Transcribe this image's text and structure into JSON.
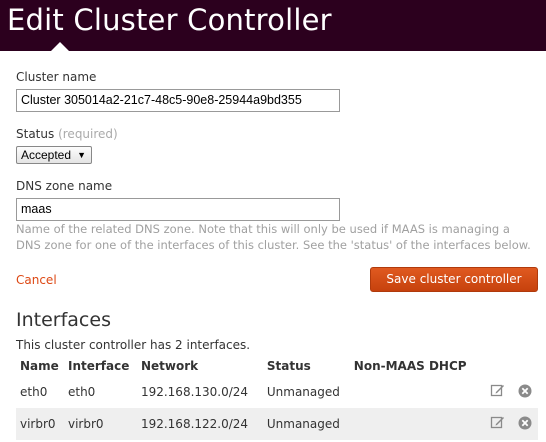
{
  "page": {
    "title": "Edit Cluster Controller"
  },
  "form": {
    "cluster_name": {
      "label": "Cluster name",
      "value": "Cluster 305014a2-21c7-48c5-90e8-25944a9bd355"
    },
    "status": {
      "label": "Status",
      "required_note": "(required)",
      "value": "Accepted"
    },
    "dns_zone": {
      "label": "DNS zone name",
      "value": "maas",
      "help": "Name of the related DNS zone. Note that this will only be used if MAAS is managing a DNS zone for one of the interfaces of this cluster. See the 'status' of the interfaces below."
    },
    "cancel_label": "Cancel",
    "save_label": "Save cluster controller"
  },
  "interfaces": {
    "title": "Interfaces",
    "summary": "This cluster controller has 2 interfaces.",
    "columns": [
      "Name",
      "Interface",
      "Network",
      "Status",
      "Non-MAAS DHCP"
    ],
    "rows": [
      {
        "name": "eth0",
        "interface": "eth0",
        "network": "192.168.130.0/24",
        "status": "Unmanaged",
        "dhcp": ""
      },
      {
        "name": "virbr0",
        "interface": "virbr0",
        "network": "192.168.122.0/24",
        "status": "Unmanaged",
        "dhcp": ""
      }
    ]
  },
  "icons": {
    "edit": "edit-icon",
    "delete": "delete-icon"
  },
  "colors": {
    "header_bg": "#2c001e",
    "accent": "#dd4814",
    "help_text": "#a0a0a0"
  }
}
